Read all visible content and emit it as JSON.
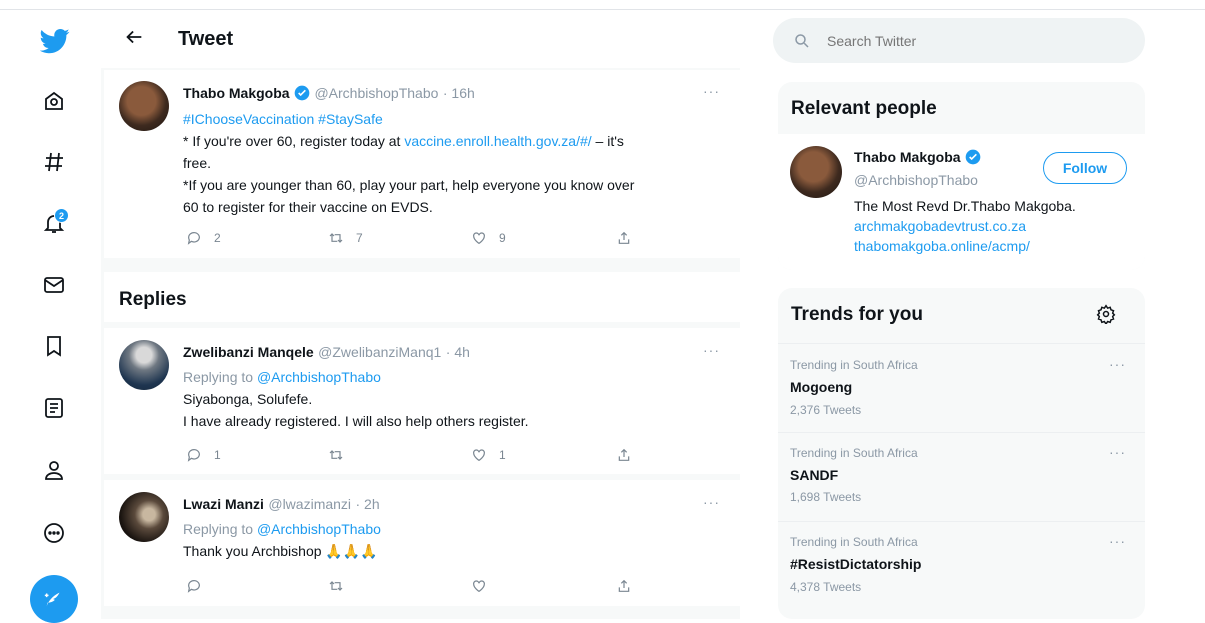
{
  "header": {
    "title": "Tweet"
  },
  "main_tweet": {
    "name": "Thabo Makgoba",
    "handle": "@ArchbishopThabo",
    "time": "· 16h",
    "hashtags": "#IChooseVaccination #StaySafe",
    "line1_prefix": "* If you're over 60, register today at ",
    "line1_link": "vaccine.enroll.health.gov.za/#/",
    "line1_suffix": " – it's",
    "line2": "free.",
    "line3": "*If you are younger than 60, play your part, help everyone you know over",
    "line4": "60 to register for their vaccine on EVDS.",
    "replies": "2",
    "retweets": "7",
    "likes": "9"
  },
  "replies_heading": "Replies",
  "replies": [
    {
      "name": "Zwelibanzi Manqele",
      "handle": "@ZwelibanziManq1",
      "time": "· 4h",
      "replying_prefix": "Replying to ",
      "replying_to": "@ArchbishopThabo",
      "line1": "Siyabonga, Solufefe.",
      "line2": "I have already registered. I will also help others register.",
      "replies": "1",
      "retweets": "",
      "likes": "1"
    },
    {
      "name": "Lwazi Manzi",
      "handle": "@lwazimanzi",
      "time": "· 2h",
      "replying_prefix": "Replying to ",
      "replying_to": "@ArchbishopThabo",
      "line1": "Thank you Archbishop 🙏🙏🙏",
      "replies": "",
      "retweets": "",
      "likes": ""
    }
  ],
  "search": {
    "placeholder": "Search Twitter"
  },
  "relevant": {
    "heading": "Relevant people",
    "name": "Thabo Makgoba",
    "handle": "@ArchbishopThabo",
    "follow_label": "Follow",
    "bio": "The Most Revd Dr.Thabo Makgoba.",
    "link1": "archmakgobadevtrust.co.za",
    "link2": "thabomakgoba.online/acmp/"
  },
  "trends": {
    "heading": "Trends for you",
    "items": [
      {
        "context": "Trending in South Africa",
        "name": "Mogoeng",
        "count": "2,376 Tweets"
      },
      {
        "context": "Trending in South Africa",
        "name": "SANDF",
        "count": "1,698 Tweets"
      },
      {
        "context": "Trending in South Africa",
        "name": "#ResistDictatorship",
        "count": "4,378 Tweets"
      }
    ]
  },
  "nav": {
    "notification_count": "2"
  },
  "colors": {
    "accent": "#1d9bf0",
    "text": "#0f1419",
    "muted": "#8b98a5",
    "panel": "#f7f9f9"
  },
  "icons": [
    "twitter-logo-icon",
    "home-icon",
    "explore-icon",
    "notifications-icon",
    "messages-icon",
    "bookmarks-icon",
    "lists-icon",
    "profile-icon",
    "more-icon",
    "compose-icon",
    "back-arrow-icon",
    "search-icon",
    "settings-icon",
    "verified-icon",
    "reply-icon",
    "retweet-icon",
    "like-icon",
    "share-icon"
  ]
}
